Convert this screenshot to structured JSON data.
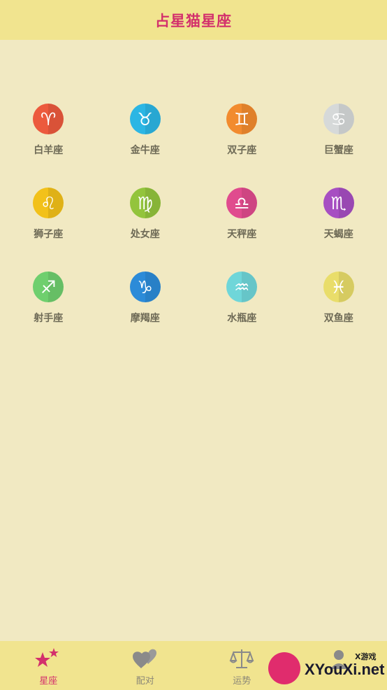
{
  "header": {
    "title": "占星猫星座"
  },
  "signs": [
    {
      "label": "白羊座",
      "glyph": "♈",
      "icon": "aries-icon",
      "color": "#ec5a3d"
    },
    {
      "label": "金牛座",
      "glyph": "♉",
      "icon": "taurus-icon",
      "color": "#2cb6e4"
    },
    {
      "label": "双子座",
      "glyph": "♊",
      "icon": "gemini-icon",
      "color": "#f28b2e"
    },
    {
      "label": "巨蟹座",
      "glyph": "♋",
      "icon": "cancer-icon",
      "color": "#d6d9d9"
    },
    {
      "label": "狮子座",
      "glyph": "♌",
      "icon": "leo-icon",
      "color": "#f2c11a"
    },
    {
      "label": "处女座",
      "glyph": "♍",
      "icon": "virgo-icon",
      "color": "#93c43c"
    },
    {
      "label": "天秤座",
      "glyph": "♎",
      "icon": "libra-icon",
      "color": "#e04b8e"
    },
    {
      "label": "天蝎座",
      "glyph": "♏",
      "icon": "scorpio-icon",
      "color": "#a74fc2"
    },
    {
      "label": "射手座",
      "glyph": "♐",
      "icon": "sagittarius-icon",
      "color": "#6fcf6e"
    },
    {
      "label": "摩羯座",
      "glyph": "♑",
      "icon": "capricorn-icon",
      "color": "#2c8bd8"
    },
    {
      "label": "水瓶座",
      "glyph": "♒",
      "icon": "aquarius-icon",
      "color": "#6fd6d9"
    },
    {
      "label": "双鱼座",
      "glyph": "♓",
      "icon": "pisces-icon",
      "color": "#e9dd6a"
    }
  ],
  "tabs": [
    {
      "label": "星座",
      "icon": "stars-icon",
      "active": true
    },
    {
      "label": "配对",
      "icon": "hearts-icon",
      "active": false
    },
    {
      "label": "运势",
      "icon": "scales-icon",
      "active": false
    },
    {
      "label": "",
      "icon": "profile-icon",
      "active": false
    }
  ],
  "watermark": {
    "text": "XYouXi.net",
    "small": "X游戏"
  },
  "colors": {
    "accent": "#d3306c",
    "header_bg": "#f1e48f",
    "page_bg": "#f1e9c2"
  }
}
